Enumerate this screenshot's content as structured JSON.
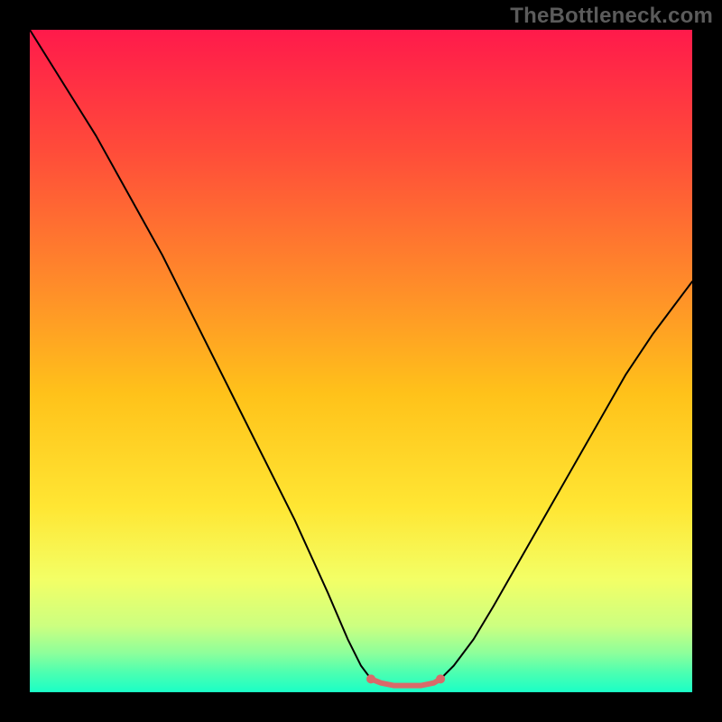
{
  "watermark": "TheBottleneck.com",
  "chart_data": {
    "type": "line",
    "title": "",
    "xlabel": "",
    "ylabel": "",
    "xlim": [
      0,
      100
    ],
    "ylim": [
      0,
      100
    ],
    "grid": false,
    "legend": false,
    "background_gradient": {
      "stops": [
        {
          "offset": 0.0,
          "color": "#ff1a4b"
        },
        {
          "offset": 0.18,
          "color": "#ff4b3a"
        },
        {
          "offset": 0.38,
          "color": "#ff8a2a"
        },
        {
          "offset": 0.55,
          "color": "#ffc21a"
        },
        {
          "offset": 0.72,
          "color": "#ffe633"
        },
        {
          "offset": 0.83,
          "color": "#f3ff66"
        },
        {
          "offset": 0.9,
          "color": "#ccff80"
        },
        {
          "offset": 0.94,
          "color": "#8fff9a"
        },
        {
          "offset": 0.97,
          "color": "#4dffb0"
        },
        {
          "offset": 1.0,
          "color": "#1affc6"
        }
      ]
    },
    "series": [
      {
        "name": "left-curve",
        "stroke": "#000000",
        "stroke_width": 2,
        "x": [
          0,
          5,
          10,
          15,
          20,
          25,
          30,
          35,
          40,
          45,
          48,
          50,
          51.5
        ],
        "y": [
          100,
          92,
          84,
          75,
          66,
          56,
          46,
          36,
          26,
          15,
          8,
          4,
          2
        ]
      },
      {
        "name": "right-curve",
        "stroke": "#000000",
        "stroke_width": 2,
        "x": [
          62,
          64,
          67,
          70,
          74,
          78,
          82,
          86,
          90,
          94,
          97,
          100
        ],
        "y": [
          2,
          4,
          8,
          13,
          20,
          27,
          34,
          41,
          48,
          54,
          58,
          62
        ]
      },
      {
        "name": "bottom-flat",
        "stroke": "#d96a6a",
        "stroke_width": 6,
        "x": [
          51.5,
          53,
          55,
          57,
          59,
          61,
          62
        ],
        "y": [
          2.0,
          1.4,
          1.0,
          1.0,
          1.0,
          1.4,
          2.0
        ]
      }
    ],
    "markers": [
      {
        "name": "left-dot",
        "x": 51.5,
        "y": 2.0,
        "r": 5,
        "fill": "#d96a6a"
      },
      {
        "name": "right-dot",
        "x": 62.0,
        "y": 2.0,
        "r": 5,
        "fill": "#d96a6a"
      }
    ]
  }
}
